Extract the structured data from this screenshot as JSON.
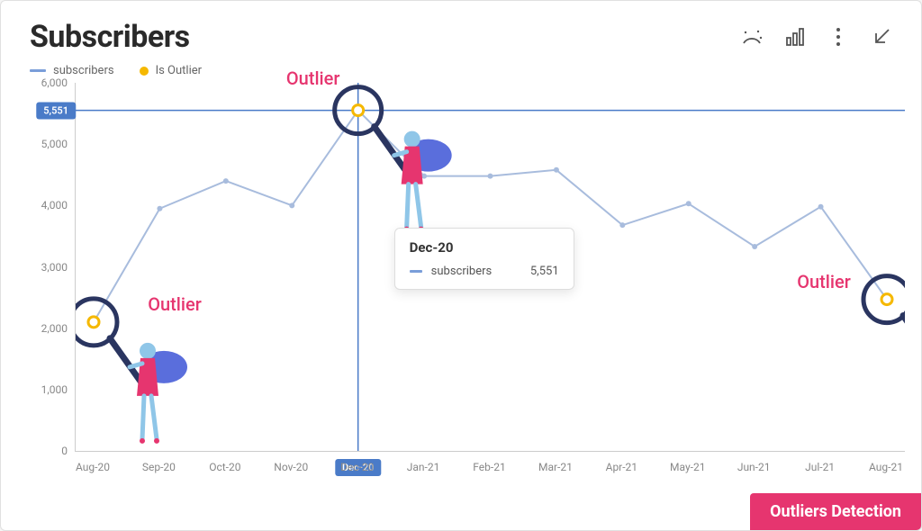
{
  "title": "Subscribers",
  "legend": {
    "series": "subscribers",
    "outlier": "Is Outlier"
  },
  "toolbar": {
    "insights": "insights",
    "chart_type": "chart-type",
    "more": "more-options",
    "expand": "expand"
  },
  "chart_data": {
    "type": "line",
    "title": "Subscribers",
    "xlabel": "",
    "ylabel": "",
    "ylim": [
      0,
      6000
    ],
    "categories": [
      "Aug-20",
      "Sep-20",
      "Oct-20",
      "Nov-20",
      "Dec-20",
      "Jan-21",
      "Feb-21",
      "Mar-21",
      "Apr-21",
      "May-21",
      "Jun-21",
      "Jul-21",
      "Aug-21"
    ],
    "series": [
      {
        "name": "subscribers",
        "values": [
          2100,
          3950,
          4400,
          4000,
          5551,
          4480,
          4480,
          4580,
          3680,
          4030,
          3330,
          3980,
          2470
        ]
      }
    ],
    "outliers": [
      0,
      4,
      12
    ],
    "y_ticks": [
      0,
      1000,
      2000,
      3000,
      4000,
      5000,
      6000
    ],
    "y_tick_labels": [
      "0",
      "1,000",
      "2,000",
      "3,000",
      "4,000",
      "5,000",
      "6,000"
    ]
  },
  "hover": {
    "index": 4,
    "x_label": "Dec-20",
    "y_label": "5,551",
    "tooltip_title": "Dec-20",
    "tooltip_series": "subscribers",
    "tooltip_value": "5,551"
  },
  "outlier_text": "Outlier",
  "footer_badge": "Outliers Detection"
}
